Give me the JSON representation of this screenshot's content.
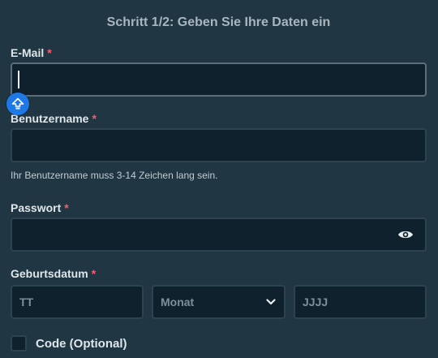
{
  "header": {
    "title": "Schritt 1/2: Geben Sie Ihre Daten ein"
  },
  "fields": {
    "email": {
      "label": "E-Mail",
      "required_mark": "*",
      "value": ""
    },
    "username": {
      "label": "Benutzername",
      "required_mark": "*",
      "value": "",
      "hint": "Ihr Benutzername muss 3-14 Zeichen lang sein."
    },
    "password": {
      "label": "Passwort",
      "required_mark": "*",
      "value": ""
    },
    "birthdate": {
      "label": "Geburtsdatum",
      "required_mark": "*",
      "day_placeholder": "TT",
      "month_placeholder": "Monat",
      "year_placeholder": "JJJJ"
    },
    "code": {
      "label": "Code (Optional)",
      "checked": false
    }
  },
  "icons": {
    "shift": "shift-arrow-icon",
    "eye": "eye-icon",
    "chevron": "chevron-down-icon"
  },
  "colors": {
    "background": "#203642",
    "input_bg": "#0f212c",
    "required": "#ff5a6b",
    "accent": "#1e78e8"
  }
}
